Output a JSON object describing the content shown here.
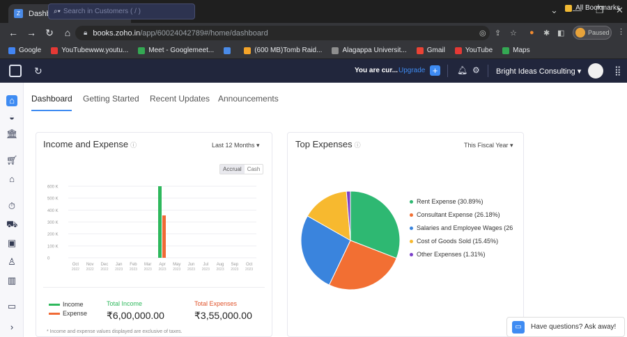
{
  "browser": {
    "tab_title": "Dashboard | Zoho Books",
    "tab_close": "×",
    "new_tab": "+",
    "url_host": "books.zoho.in",
    "url_path": "/app/60024042789#/home/dashboard",
    "profile_status": "Paused",
    "bookmarks": [
      {
        "label": "Google",
        "color": "#4285f4"
      },
      {
        "label": "YouTubewww.youtu...",
        "color": "#e53935"
      },
      {
        "label": "Meet - Googlemeet...",
        "color": "#34a853"
      },
      {
        "label": "",
        "color": "#4a8be8"
      },
      {
        "label": "(600 MB)Tomb Raid...",
        "color": "#f4a429"
      },
      {
        "label": "Alagappa Universit...",
        "color": "#8e8e8e"
      },
      {
        "label": "Gmail",
        "color": "#ea4335"
      },
      {
        "label": "YouTube",
        "color": "#e53935"
      },
      {
        "label": "Maps",
        "color": "#34a853"
      }
    ],
    "all_bookmarks": "All Bookmarks"
  },
  "header": {
    "search_placeholder": "Search in Customers ( / )",
    "trial_text": "You are cur...",
    "upgrade": "Upgrade",
    "org_name": "Bright Ideas Consulting ▾"
  },
  "subtabs": [
    "Dashboard",
    "Getting Started",
    "Recent Updates",
    "Announcements"
  ],
  "income_card": {
    "title": "Income and Expense",
    "filter": "Last 12 Months ▾",
    "toggle": [
      "Accrual",
      "Cash"
    ],
    "legend": [
      {
        "label": "Income",
        "color": "#2eb85c"
      },
      {
        "label": "Expense",
        "color": "#f06a35"
      }
    ],
    "total_income_label": "Total Income",
    "total_income_value": "₹6,00,000.00",
    "total_expense_label": "Total Expenses",
    "total_expense_value": "₹3,55,000.00",
    "footnote": "* Income and expense values displayed are exclusive of taxes."
  },
  "expense_card": {
    "title": "Top Expenses",
    "filter": "This Fiscal Year ▾"
  },
  "chat": {
    "text": "Have questions? Ask away!"
  },
  "chart_data": [
    {
      "type": "bar",
      "title": "Income and Expense",
      "categories": [
        "Oct 2022",
        "Nov 2022",
        "Dec 2022",
        "Jan 2023",
        "Feb 2023",
        "Mar 2023",
        "Apr 2023",
        "May 2023",
        "Jun 2023",
        "Jul 2023",
        "Aug 2023",
        "Sep 2023",
        "Oct 2023"
      ],
      "category_labels": [
        [
          "Oct",
          "2022"
        ],
        [
          "Nov",
          "2022"
        ],
        [
          "Dec",
          "2022"
        ],
        [
          "Jan",
          "2023"
        ],
        [
          "Feb",
          "2023"
        ],
        [
          "Mar",
          "2023"
        ],
        [
          "Apr",
          "2023"
        ],
        [
          "May",
          "2023"
        ],
        [
          "Jun",
          "2023"
        ],
        [
          "Jul",
          "2023"
        ],
        [
          "Aug",
          "2023"
        ],
        [
          "Sep",
          "2023"
        ],
        [
          "Oct",
          "2023"
        ]
      ],
      "series": [
        {
          "name": "Income",
          "color": "#2eb85c",
          "values": [
            0,
            0,
            0,
            0,
            0,
            0,
            600000,
            0,
            0,
            0,
            0,
            0,
            0
          ]
        },
        {
          "name": "Expense",
          "color": "#f06a35",
          "values": [
            0,
            0,
            0,
            0,
            0,
            0,
            355000,
            0,
            0,
            0,
            0,
            0,
            0
          ]
        }
      ],
      "yticks": [
        0,
        100000,
        200000,
        300000,
        400000,
        500000,
        600000
      ],
      "ytick_labels": [
        "0",
        "100 K",
        "200 K",
        "300 K",
        "400 K",
        "500 K",
        "600 K"
      ],
      "ylim": [
        0,
        600000
      ],
      "grid": true
    },
    {
      "type": "pie",
      "title": "Top Expenses",
      "slices": [
        {
          "label": "Rent Expense (30.89%)",
          "value": 30.89,
          "color": "#2eb872"
        },
        {
          "label": "Consultant Expense (26.18%)",
          "value": 26.18,
          "color": "#f26f33"
        },
        {
          "label": "Salaries and Employee Wages (26",
          "value": 26.17,
          "color": "#3a84dd"
        },
        {
          "label": "Cost of Goods Sold (15.45%)",
          "value": 15.45,
          "color": "#f7b92f"
        },
        {
          "label": "Other Expenses (1.31%)",
          "value": 1.31,
          "color": "#7b3fc9"
        }
      ]
    }
  ]
}
